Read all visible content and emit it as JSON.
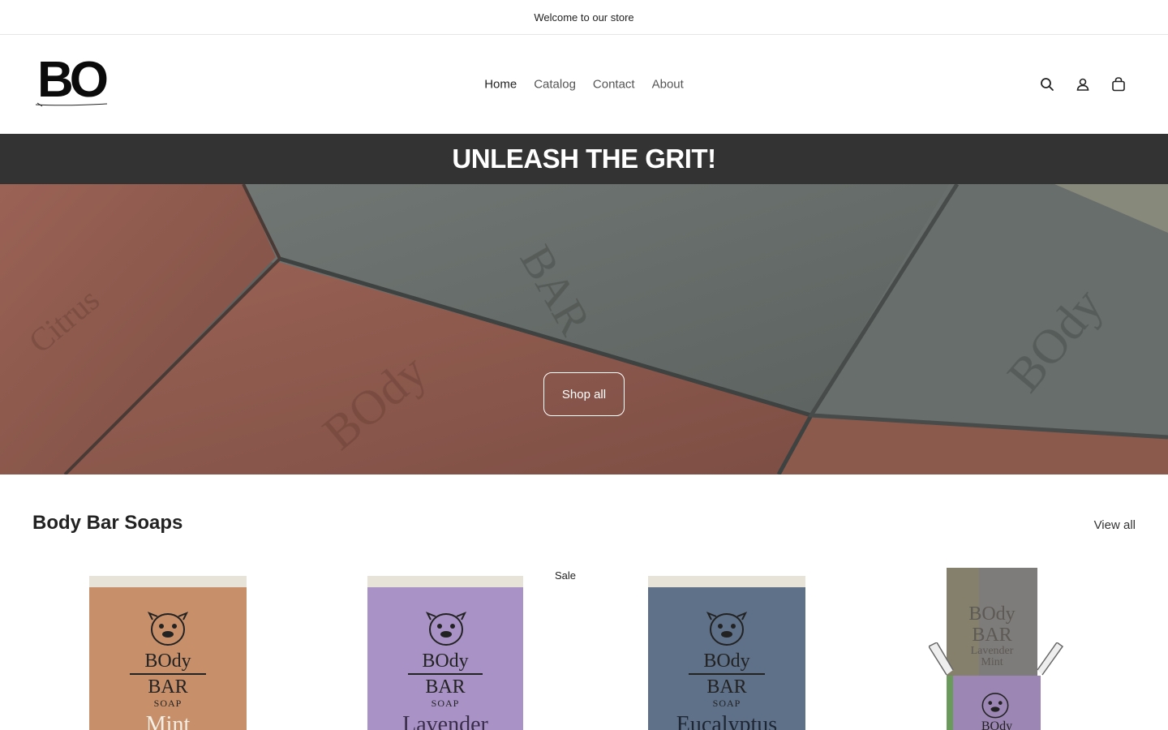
{
  "announcement": {
    "text": "Welcome to our store"
  },
  "header": {
    "logo_text": "BO",
    "nav": [
      {
        "label": "Home"
      },
      {
        "label": "Catalog"
      },
      {
        "label": "Contact"
      },
      {
        "label": "About"
      }
    ],
    "icons": [
      "search-icon",
      "account-icon",
      "cart-icon"
    ]
  },
  "banner": {
    "heading": "UNLEASH THE GRIT!"
  },
  "hero": {
    "button_label": "Shop all"
  },
  "collection": {
    "title": "Body Bar Soaps",
    "view_all": "View all",
    "products": [
      {
        "badge": "",
        "box_color": "#c8906a",
        "brand_1": "BOdy",
        "brand_2": "BAR",
        "brand_3": "SOAP",
        "flavor": "Mint"
      },
      {
        "badge": "Sale",
        "box_color": "#a993c6",
        "brand_1": "BOdy",
        "brand_2": "BAR",
        "brand_3": "SOAP",
        "flavor": "Lavender"
      },
      {
        "badge": "",
        "box_color": "#5e7189",
        "brand_1": "BOdy",
        "brand_2": "BAR",
        "brand_3": "SOAP",
        "flavor": "Eucalyptus"
      },
      {
        "badge": "",
        "box_color": "#9c86b4",
        "brand_1": "BOdy",
        "brand_2": "",
        "brand_3": "",
        "flavor": "",
        "soap_text_1": "BOdy",
        "soap_text_2": "BAR",
        "soap_text_3": "Lavender",
        "soap_text_4": "Mint"
      }
    ]
  },
  "colors": {
    "banner_bg": "#333333",
    "text": "#222222"
  }
}
